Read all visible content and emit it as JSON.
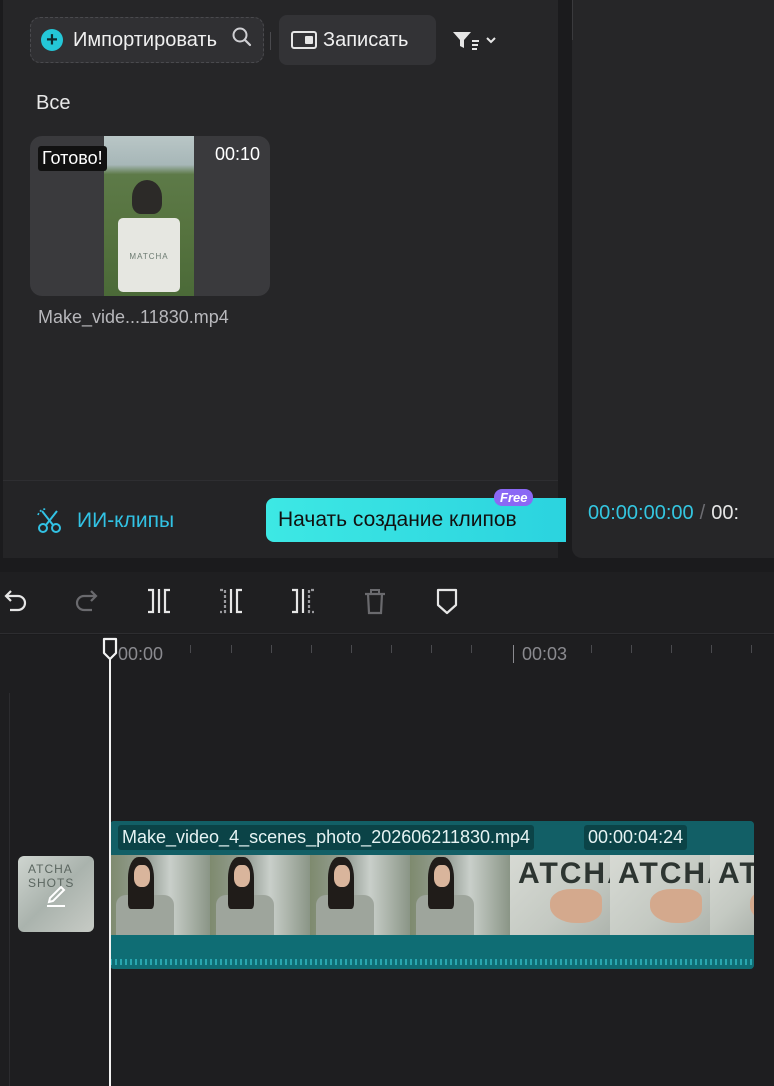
{
  "media": {
    "import_label": "Импортировать",
    "record_label": "Записать",
    "all_label": "Все",
    "items": [
      {
        "status": "Готово!",
        "duration": "00:10",
        "filename": "Make_vide...11830.mp4",
        "thumb_text": "MATCHA"
      }
    ],
    "ai_clips_label": "ИИ-клипы",
    "start_create_label": "Начать создание клипов",
    "free_badge": "Free"
  },
  "player": {
    "current_time": "00:00:00:00",
    "separator": "/",
    "total_time": "00:"
  },
  "timeline": {
    "ruler_labels": [
      "00:00",
      "00:03"
    ],
    "cover_text": "ATCHA SHOTS",
    "clip": {
      "name": "Make_video_4_scenes_photo_202606211830.mp4",
      "duration": "00:00:04:24",
      "frame_text": "ATCHA"
    }
  },
  "colors": {
    "accent": "#34c6e0",
    "clip": "#0c5d63",
    "free_badge": "#8a68f5",
    "cta": "#3de8e4"
  },
  "icons": {
    "import": "plus-circle-icon",
    "search": "search-icon",
    "record": "record-screen-icon",
    "filter": "filter-icon",
    "ai": "ai-scissors-icon",
    "undo": "undo-icon",
    "redo": "redo-icon",
    "split": "split-icon",
    "split_left": "split-left-icon",
    "split_right": "split-right-icon",
    "delete": "trash-icon",
    "marker": "marker-icon",
    "edit_cover": "pencil-icon"
  }
}
